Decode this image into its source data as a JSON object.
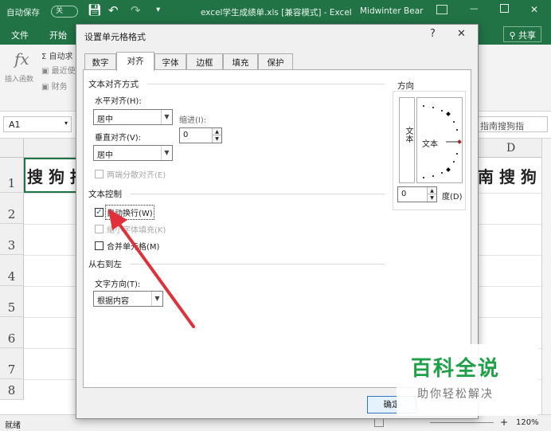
{
  "window": {
    "autosave": "自动保存",
    "autosave_state": "关",
    "doc_title": "excel学生成绩单.xls  [兼容模式]  -  Excel",
    "user": "Midwinter Bear",
    "ribbon_tabs": [
      "文件",
      "开始"
    ],
    "share": "共享"
  },
  "ribbon": {
    "fx_label": "插入函数",
    "items": [
      "自动求",
      "最近使",
      "财务"
    ]
  },
  "formula_bar": {
    "name_box": "A1",
    "right_text": "指南搜狗指"
  },
  "sheet": {
    "column_d": "D",
    "rows": [
      "1",
      "2",
      "3",
      "4",
      "5",
      "6",
      "7",
      "8"
    ],
    "a1_text": "搜 狗 指",
    "d1_text": "南 搜 狗",
    "status": "就绪",
    "zoom": "120%"
  },
  "dialog": {
    "title": "设置单元格格式",
    "help": "?",
    "close": "✕",
    "tabs": [
      "数字",
      "对齐",
      "字体",
      "边框",
      "填充",
      "保护"
    ],
    "active_tab": "对齐",
    "text_align_section": "文本对齐方式",
    "horizontal_label": "水平对齐(H):",
    "horizontal_value": "居中",
    "indent_label": "缩进(I):",
    "indent_value": "0",
    "vertical_label": "垂直对齐(V):",
    "vertical_value": "居中",
    "distributed_label": "两端分散对齐(E)",
    "text_control_section": "文本控制",
    "wrap_text_label": "自动换行(W)",
    "wrap_text_checked": true,
    "shrink_label": "缩小字体填充(K)",
    "merge_label": "合并单元格(M)",
    "rtl_section": "从右到左",
    "direction_label": "文字方向(T):",
    "direction_value": "根据内容",
    "orientation_section": "方向",
    "vertical_text": "文本",
    "orient_text": "文本",
    "degrees_value": "0",
    "degrees_label": "度(D)",
    "ok_label": "确定"
  },
  "watermark": {
    "brand": "百科全说",
    "slogan": "助你轻松解决"
  },
  "colors": {
    "excel_green": "#217346",
    "annotation_red": "#e0303a",
    "watermark_green": "#1ea048"
  },
  "icons": [
    "save-icon",
    "undo-icon",
    "redo-icon",
    "fx-icon",
    "autosum-icon",
    "share-icon",
    "spin-up-icon",
    "spin-down-icon",
    "dropdown-arrow-icon",
    "close-icon",
    "arrow-annotation-icon"
  ]
}
